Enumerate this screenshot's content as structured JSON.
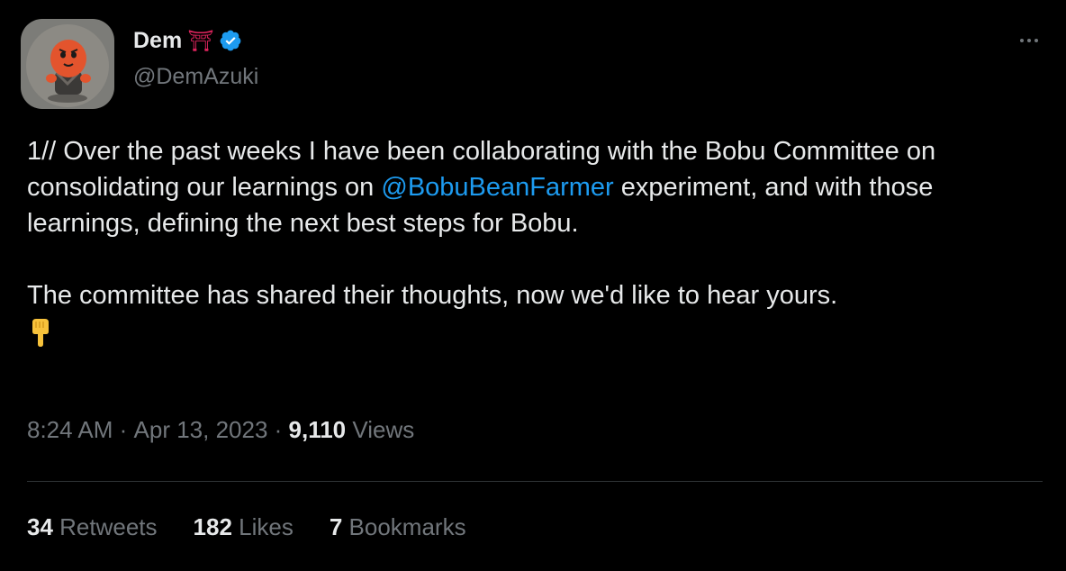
{
  "author": {
    "display_name": "Dem",
    "name_emoji": "⛩",
    "handle": "@DemAzuki",
    "verified": true
  },
  "tweet": {
    "paragraph1_before": "1// Over the past weeks I have been collaborating with the Bobu Committee on consolidating our learnings on ",
    "mention": "@BobuBeanFarmer",
    "paragraph1_after": " experiment, and with those learnings, defining the next best steps for Bobu.",
    "paragraph2": "The committee has shared their thoughts, now we'd like to hear yours.",
    "emoji": "backhand-index-pointing-down"
  },
  "meta": {
    "time": "8:24 AM",
    "separator": " · ",
    "date": "Apr 13, 2023",
    "views_count": "9,110",
    "views_label": " Views"
  },
  "stats": {
    "retweets_count": "34",
    "retweets_label": " Retweets",
    "likes_count": "182",
    "likes_label": " Likes",
    "bookmarks_count": "7",
    "bookmarks_label": " Bookmarks"
  },
  "colors": {
    "background": "#000000",
    "text": "#e7e9ea",
    "secondary": "#71767b",
    "link": "#1d9bf0",
    "divider": "#2f3336"
  }
}
